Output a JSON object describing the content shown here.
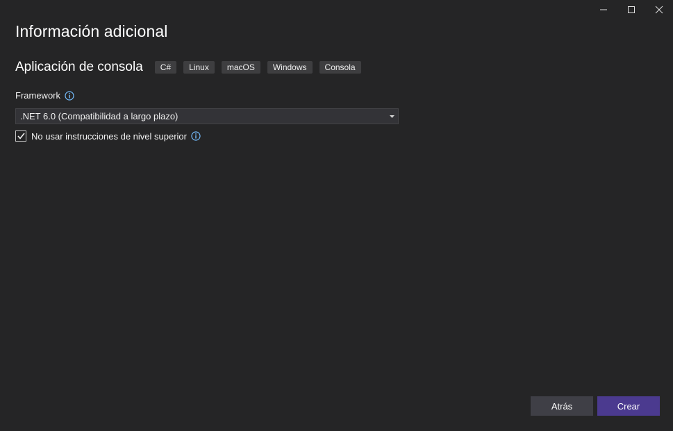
{
  "window": {
    "controls": [
      "minimize",
      "maximize",
      "close"
    ]
  },
  "header": {
    "title": "Información adicional"
  },
  "project": {
    "name": "Aplicación de consola",
    "tags": [
      "C#",
      "Linux",
      "macOS",
      "Windows",
      "Consola"
    ]
  },
  "framework": {
    "label": "Framework",
    "selected": ".NET 6.0 (Compatibilidad a largo plazo)"
  },
  "top_level": {
    "label": "No usar instrucciones de nivel superior",
    "checked": true
  },
  "footer": {
    "back_label": "Atrás",
    "create_label": "Crear"
  },
  "colors": {
    "background": "#252526",
    "info_icon": "#75beff",
    "primary_button": "#4b3a8f",
    "secondary_button": "#3f3f46"
  }
}
